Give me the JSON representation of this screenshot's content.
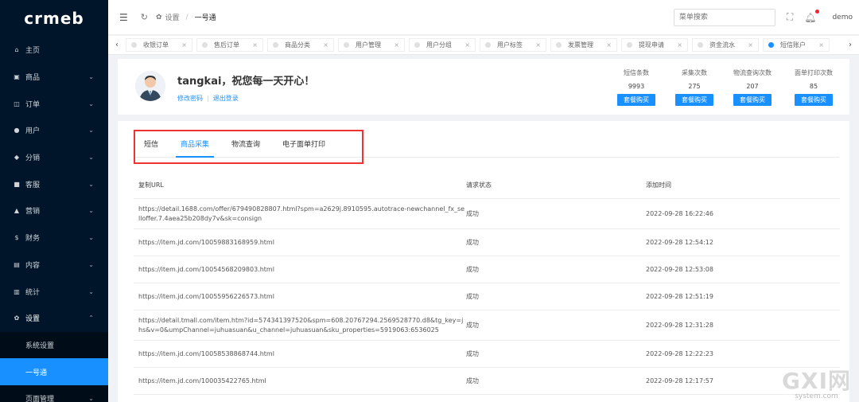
{
  "logo": "crmeb",
  "sidebar": {
    "items": [
      {
        "label": "主页",
        "icon": "home-icon",
        "glyph": "⌂",
        "chevron": ""
      },
      {
        "label": "商品",
        "icon": "goods-icon",
        "glyph": "▣",
        "chevron": "⌄"
      },
      {
        "label": "订单",
        "icon": "cart-icon",
        "glyph": "◫",
        "chevron": "⌄"
      },
      {
        "label": "用户",
        "icon": "user-icon",
        "glyph": "●",
        "chevron": "⌄"
      },
      {
        "label": "分销",
        "icon": "share-icon",
        "glyph": "◆",
        "chevron": "⌄"
      },
      {
        "label": "客服",
        "icon": "chat-icon",
        "glyph": "■",
        "chevron": "⌄"
      },
      {
        "label": "营销",
        "icon": "send-icon",
        "glyph": "▲",
        "chevron": "⌄"
      },
      {
        "label": "财务",
        "icon": "finance-icon",
        "glyph": "$",
        "chevron": "⌄"
      },
      {
        "label": "内容",
        "icon": "content-icon",
        "glyph": "▤",
        "chevron": "⌄"
      },
      {
        "label": "统计",
        "icon": "stats-icon",
        "glyph": "▥",
        "chevron": "⌄"
      },
      {
        "label": "设置",
        "icon": "gear-icon",
        "glyph": "✿",
        "chevron": "⌃"
      }
    ],
    "sub_items": [
      {
        "label": "系统设置",
        "active": false
      },
      {
        "label": "一号通",
        "active": true
      },
      {
        "label": "页面管理",
        "active": false
      }
    ]
  },
  "header": {
    "breadcrumb_parent": "设置",
    "breadcrumb_sep": "/",
    "breadcrumb_current": "一号通",
    "search_placeholder": "菜单搜索",
    "user": "demo"
  },
  "tabs": [
    {
      "label": "收银订单",
      "active": false
    },
    {
      "label": "售后订单",
      "active": false
    },
    {
      "label": "商品分类",
      "active": false
    },
    {
      "label": "用户管理",
      "active": false
    },
    {
      "label": "用户分组",
      "active": false
    },
    {
      "label": "用户标签",
      "active": false
    },
    {
      "label": "发票管理",
      "active": false
    },
    {
      "label": "提现申请",
      "active": false
    },
    {
      "label": "资金流水",
      "active": false
    },
    {
      "label": "短信账户",
      "active": true
    }
  ],
  "account": {
    "greeting": "tangkai，祝您每一天开心！",
    "change_password": "修改密码",
    "logout": "退出登录",
    "stats": [
      {
        "label": "短信条数",
        "value": "9993",
        "button": "套餐购买"
      },
      {
        "label": "采集次数",
        "value": "275",
        "button": "套餐购买"
      },
      {
        "label": "物流查询次数",
        "value": "207",
        "button": "套餐购买"
      },
      {
        "label": "面单打印次数",
        "value": "85",
        "button": "套餐购买"
      }
    ]
  },
  "content_tabs": [
    {
      "label": "短信",
      "active": false
    },
    {
      "label": "商品采集",
      "active": true
    },
    {
      "label": "物流查询",
      "active": false
    },
    {
      "label": "电子面单打印",
      "active": false
    }
  ],
  "table": {
    "headers": [
      "复制URL",
      "请求状态",
      "添加时间"
    ],
    "rows": [
      {
        "url": "https://detail.1688.com/offer/679490828807.html?spm=a2629j.8910595.autotrace-newchannel_fx_selloffer.7.4aea25b208dy7v&sk=consign",
        "status": "成功",
        "time": "2022-09-28 16:22:46",
        "tall": true
      },
      {
        "url": "https://item.jd.com/10059883168959.html",
        "status": "成功",
        "time": "2022-09-28 12:54:12",
        "tall": false
      },
      {
        "url": "https://item.jd.com/10054568209803.html",
        "status": "成功",
        "time": "2022-09-28 12:53:08",
        "tall": false
      },
      {
        "url": "https://item.jd.com/10055956226573.html",
        "status": "成功",
        "time": "2022-09-28 12:51:19",
        "tall": false
      },
      {
        "url": "https://detail.tmall.com/item.htm?id=574341397520&spm=608.20767294.2569528770.d8&tg_key=jhs&v=0&umpChannel=juhuasuan&u_channel=juhuasuan&sku_properties=5919063:6536025",
        "status": "成功",
        "time": "2022-09-28 12:31:28",
        "tall": true
      },
      {
        "url": "https://item.jd.com/10058538868744.html",
        "status": "成功",
        "time": "2022-09-28 12:22:23",
        "tall": false
      },
      {
        "url": "https://item.jd.com/100035422765.html",
        "status": "成功",
        "time": "2022-09-28 12:17:57",
        "tall": false
      }
    ]
  },
  "watermark": {
    "main": "GXI网",
    "sub": "system.com"
  }
}
